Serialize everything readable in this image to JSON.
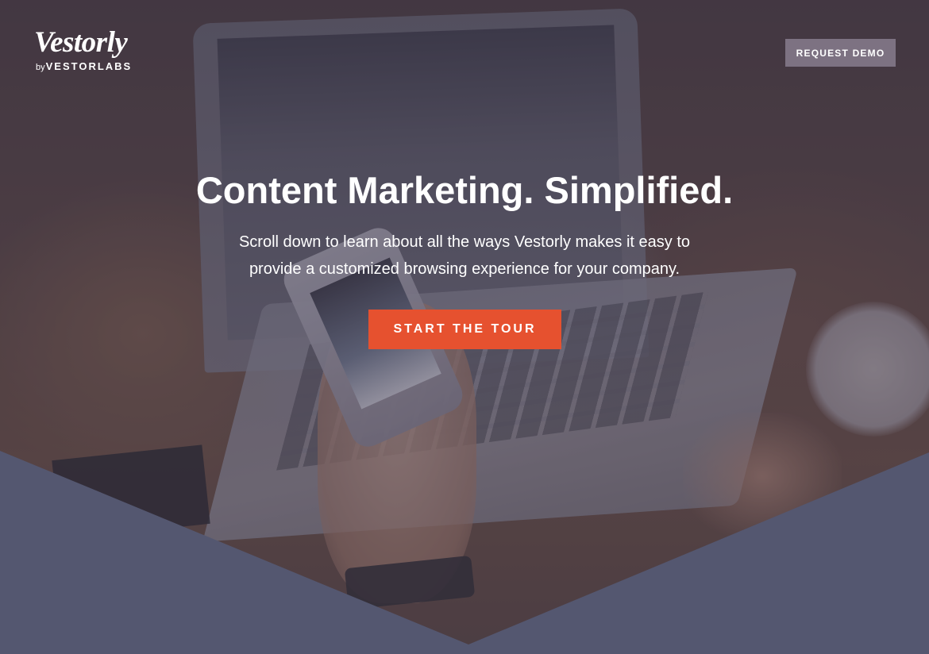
{
  "brand": {
    "name": "Vestorly",
    "by": "by",
    "company": "VESTORLABS"
  },
  "header": {
    "request_demo_label": "REQUEST DEMO"
  },
  "hero": {
    "headline": "Content Marketing. Simplified.",
    "subtext": "Scroll down to learn about all the ways Vestorly makes it easy to provide a customized browsing experience for your company.",
    "cta_label": "START THE TOUR",
    "background_image": "hero-photo-laptop-phone"
  },
  "colors": {
    "cta": "#e6512f",
    "chevron": "#545770",
    "overlay": "#3a3448"
  }
}
